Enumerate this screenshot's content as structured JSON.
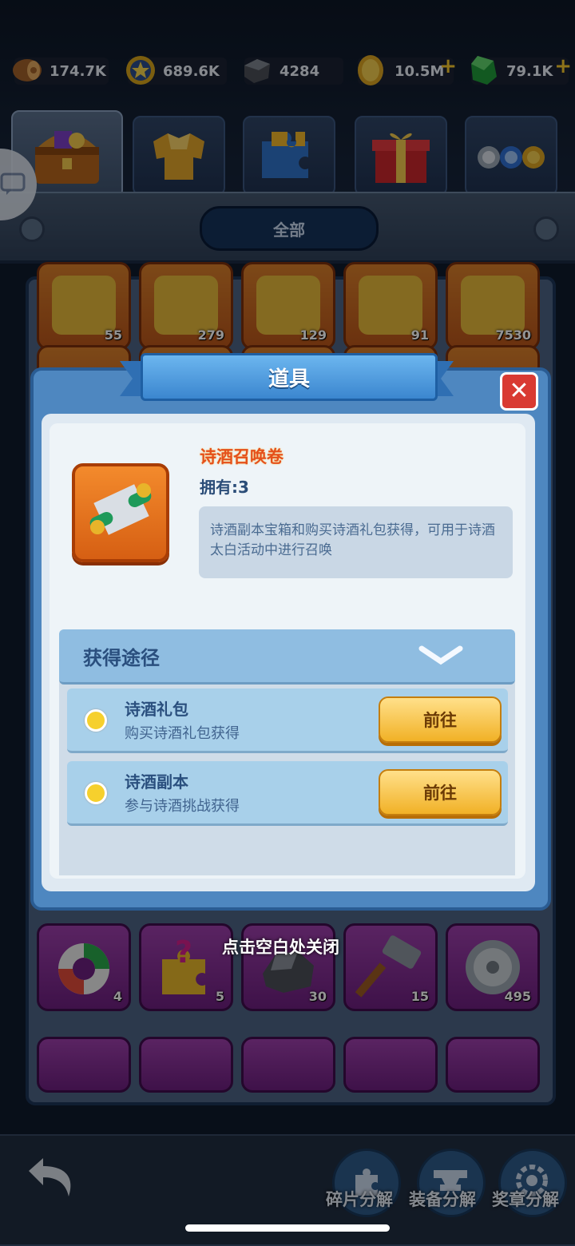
{
  "resources": [
    {
      "name": "wood",
      "value": "174.7K",
      "icon": "log-icon"
    },
    {
      "name": "medal",
      "value": "689.6K",
      "icon": "star-medal-icon"
    },
    {
      "name": "iron",
      "value": "4284",
      "icon": "iron-ore-icon"
    },
    {
      "name": "gold",
      "value": "10.5M",
      "icon": "gold-coin-icon",
      "plus": "+"
    },
    {
      "name": "gem",
      "value": "79.1K",
      "icon": "green-gem-icon",
      "plus": "+"
    }
  ],
  "tabs": [
    {
      "name": "chest",
      "icon": "treasure-chest-icon",
      "active": true
    },
    {
      "name": "armor",
      "icon": "armor-icon"
    },
    {
      "name": "puzzle",
      "icon": "puzzle-piece-icon"
    },
    {
      "name": "gift",
      "icon": "gift-box-icon"
    },
    {
      "name": "coins",
      "icon": "token-coins-icon"
    }
  ],
  "filter": {
    "label": "全部"
  },
  "top_row_counts": [
    "55",
    "279",
    "129",
    "91",
    "7530"
  ],
  "purple_row_counts": [
    "4",
    "5",
    "30",
    "15",
    "495"
  ],
  "dialog": {
    "title": "道具",
    "close_symbol": "✕",
    "item_name": "诗酒召唤卷",
    "own_label": "拥有:3",
    "description": "诗酒副本宝箱和购买诗酒礼包获得，可用于诗酒太白活动中进行召唤",
    "source_header": "获得途径",
    "sources": [
      {
        "title": "诗酒礼包",
        "subtitle": "购买诗酒礼包获得",
        "button": "前往"
      },
      {
        "title": "诗酒副本",
        "subtitle": "参与诗酒挑战获得",
        "button": "前往"
      }
    ]
  },
  "close_hint": "点击空白处关闭",
  "bottom": {
    "back_icon": "back-arrow-icon",
    "buttons": [
      {
        "label": "碎片分解",
        "icon": "fragment-icon"
      },
      {
        "label": "装备分解",
        "icon": "anvil-icon"
      },
      {
        "label": "奖章分解",
        "icon": "gear-medal-icon"
      }
    ]
  },
  "colors": {
    "accent": "#f1b126",
    "dialog": "#4e87c0",
    "title_orange": "#e5501b"
  }
}
